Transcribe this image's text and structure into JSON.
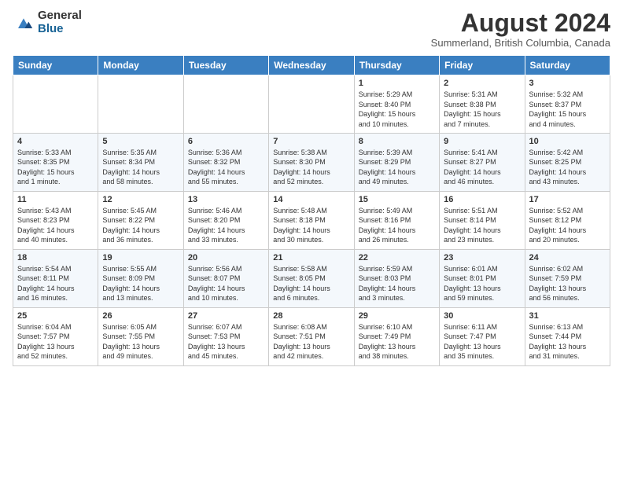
{
  "logo": {
    "general": "General",
    "blue": "Blue"
  },
  "title": "August 2024",
  "location": "Summerland, British Columbia, Canada",
  "weekdays": [
    "Sunday",
    "Monday",
    "Tuesday",
    "Wednesday",
    "Thursday",
    "Friday",
    "Saturday"
  ],
  "rows": [
    [
      {
        "day": "",
        "info": ""
      },
      {
        "day": "",
        "info": ""
      },
      {
        "day": "",
        "info": ""
      },
      {
        "day": "",
        "info": ""
      },
      {
        "day": "1",
        "info": "Sunrise: 5:29 AM\nSunset: 8:40 PM\nDaylight: 15 hours\nand 10 minutes."
      },
      {
        "day": "2",
        "info": "Sunrise: 5:31 AM\nSunset: 8:38 PM\nDaylight: 15 hours\nand 7 minutes."
      },
      {
        "day": "3",
        "info": "Sunrise: 5:32 AM\nSunset: 8:37 PM\nDaylight: 15 hours\nand 4 minutes."
      }
    ],
    [
      {
        "day": "4",
        "info": "Sunrise: 5:33 AM\nSunset: 8:35 PM\nDaylight: 15 hours\nand 1 minute."
      },
      {
        "day": "5",
        "info": "Sunrise: 5:35 AM\nSunset: 8:34 PM\nDaylight: 14 hours\nand 58 minutes."
      },
      {
        "day": "6",
        "info": "Sunrise: 5:36 AM\nSunset: 8:32 PM\nDaylight: 14 hours\nand 55 minutes."
      },
      {
        "day": "7",
        "info": "Sunrise: 5:38 AM\nSunset: 8:30 PM\nDaylight: 14 hours\nand 52 minutes."
      },
      {
        "day": "8",
        "info": "Sunrise: 5:39 AM\nSunset: 8:29 PM\nDaylight: 14 hours\nand 49 minutes."
      },
      {
        "day": "9",
        "info": "Sunrise: 5:41 AM\nSunset: 8:27 PM\nDaylight: 14 hours\nand 46 minutes."
      },
      {
        "day": "10",
        "info": "Sunrise: 5:42 AM\nSunset: 8:25 PM\nDaylight: 14 hours\nand 43 minutes."
      }
    ],
    [
      {
        "day": "11",
        "info": "Sunrise: 5:43 AM\nSunset: 8:23 PM\nDaylight: 14 hours\nand 40 minutes."
      },
      {
        "day": "12",
        "info": "Sunrise: 5:45 AM\nSunset: 8:22 PM\nDaylight: 14 hours\nand 36 minutes."
      },
      {
        "day": "13",
        "info": "Sunrise: 5:46 AM\nSunset: 8:20 PM\nDaylight: 14 hours\nand 33 minutes."
      },
      {
        "day": "14",
        "info": "Sunrise: 5:48 AM\nSunset: 8:18 PM\nDaylight: 14 hours\nand 30 minutes."
      },
      {
        "day": "15",
        "info": "Sunrise: 5:49 AM\nSunset: 8:16 PM\nDaylight: 14 hours\nand 26 minutes."
      },
      {
        "day": "16",
        "info": "Sunrise: 5:51 AM\nSunset: 8:14 PM\nDaylight: 14 hours\nand 23 minutes."
      },
      {
        "day": "17",
        "info": "Sunrise: 5:52 AM\nSunset: 8:12 PM\nDaylight: 14 hours\nand 20 minutes."
      }
    ],
    [
      {
        "day": "18",
        "info": "Sunrise: 5:54 AM\nSunset: 8:11 PM\nDaylight: 14 hours\nand 16 minutes."
      },
      {
        "day": "19",
        "info": "Sunrise: 5:55 AM\nSunset: 8:09 PM\nDaylight: 14 hours\nand 13 minutes."
      },
      {
        "day": "20",
        "info": "Sunrise: 5:56 AM\nSunset: 8:07 PM\nDaylight: 14 hours\nand 10 minutes."
      },
      {
        "day": "21",
        "info": "Sunrise: 5:58 AM\nSunset: 8:05 PM\nDaylight: 14 hours\nand 6 minutes."
      },
      {
        "day": "22",
        "info": "Sunrise: 5:59 AM\nSunset: 8:03 PM\nDaylight: 14 hours\nand 3 minutes."
      },
      {
        "day": "23",
        "info": "Sunrise: 6:01 AM\nSunset: 8:01 PM\nDaylight: 13 hours\nand 59 minutes."
      },
      {
        "day": "24",
        "info": "Sunrise: 6:02 AM\nSunset: 7:59 PM\nDaylight: 13 hours\nand 56 minutes."
      }
    ],
    [
      {
        "day": "25",
        "info": "Sunrise: 6:04 AM\nSunset: 7:57 PM\nDaylight: 13 hours\nand 52 minutes."
      },
      {
        "day": "26",
        "info": "Sunrise: 6:05 AM\nSunset: 7:55 PM\nDaylight: 13 hours\nand 49 minutes."
      },
      {
        "day": "27",
        "info": "Sunrise: 6:07 AM\nSunset: 7:53 PM\nDaylight: 13 hours\nand 45 minutes."
      },
      {
        "day": "28",
        "info": "Sunrise: 6:08 AM\nSunset: 7:51 PM\nDaylight: 13 hours\nand 42 minutes."
      },
      {
        "day": "29",
        "info": "Sunrise: 6:10 AM\nSunset: 7:49 PM\nDaylight: 13 hours\nand 38 minutes."
      },
      {
        "day": "30",
        "info": "Sunrise: 6:11 AM\nSunset: 7:47 PM\nDaylight: 13 hours\nand 35 minutes."
      },
      {
        "day": "31",
        "info": "Sunrise: 6:13 AM\nSunset: 7:44 PM\nDaylight: 13 hours\nand 31 minutes."
      }
    ]
  ]
}
